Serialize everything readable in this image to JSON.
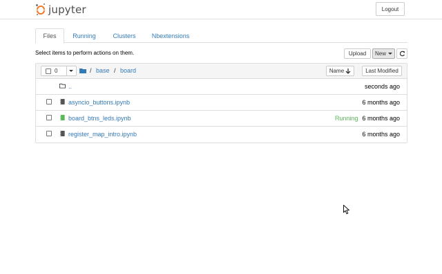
{
  "header": {
    "logo_text": "jupyter",
    "logout_label": "Logout"
  },
  "tabs": [
    {
      "label": "Files",
      "active": true
    },
    {
      "label": "Running",
      "active": false
    },
    {
      "label": "Clusters",
      "active": false
    },
    {
      "label": "Nbextensions",
      "active": false
    }
  ],
  "toolbar": {
    "info_text": "Select items to perform actions on them.",
    "upload_label": "Upload",
    "new_label": "New",
    "refresh_icon": "refresh-icon"
  },
  "list_header": {
    "selected_count": "0",
    "breadcrumb": {
      "separator": "/",
      "items": [
        "base",
        "board"
      ]
    },
    "sort_name_label": "Name",
    "sort_modified_label": "Last Modified"
  },
  "files": [
    {
      "name": "..",
      "type": "folder",
      "status": "",
      "modified": "seconds ago"
    },
    {
      "name": "asyncio_buttons.ipynb",
      "type": "notebook",
      "status": "",
      "modified": "6 months ago"
    },
    {
      "name": "board_btns_leds.ipynb",
      "type": "notebook-running",
      "status": "Running",
      "modified": "6 months ago"
    },
    {
      "name": "register_map_intro.ipynb",
      "type": "notebook",
      "status": "",
      "modified": "6 months ago"
    }
  ],
  "colors": {
    "link": "#337ab7",
    "running": "#5cb85c",
    "brand": "#f37726"
  }
}
